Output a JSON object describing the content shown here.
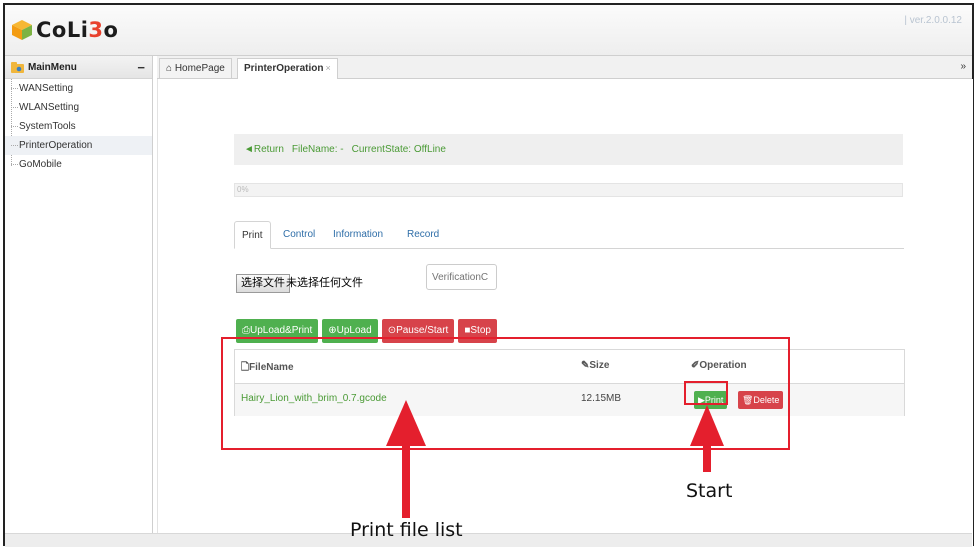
{
  "app": {
    "logo_text_a": "CoLi",
    "logo_text_b": "3",
    "logo_text_c": "o",
    "version": "| ver.2.0.0.12"
  },
  "sidebar": {
    "title": "MainMenu",
    "collapse_label": "−",
    "items": [
      {
        "label": "WANSetting"
      },
      {
        "label": "WLANSetting"
      },
      {
        "label": "SystemTools"
      },
      {
        "label": "PrinterOperation"
      },
      {
        "label": "GoMobile"
      }
    ]
  },
  "tabs": [
    {
      "label": "⌂ HomePage"
    },
    {
      "label": "PrinterOperation",
      "close": "×"
    }
  ],
  "tab_menu_icon": "»",
  "status": {
    "return_label": "◄Return",
    "filename": "FileName: -",
    "current_state": "CurrentState: OffLine"
  },
  "progress": {
    "value": 0,
    "label": "0%"
  },
  "op_tabs": [
    {
      "label": "Print"
    },
    {
      "label": "Control"
    },
    {
      "label": "Information"
    },
    {
      "label": "Record"
    }
  ],
  "upload": {
    "choose_file": "选择文件",
    "no_file": "未选择任何文件",
    "verification_placeholder": "VerificationC"
  },
  "buttons": {
    "upload_print": "⎙UpLoad&Print",
    "upload": "⊕UpLoad",
    "pause_start": "⊙Pause/Start",
    "stop": "■Stop"
  },
  "file_table": {
    "headers": {
      "filename": "🗋FileName",
      "size": "✎Size",
      "operation": "✐Operation"
    },
    "rows": [
      {
        "filename": "Hairy_Lion_with_brim_0.7.gcode",
        "size": "12.15MB",
        "print": "▶Print",
        "delete": "🗑Delete"
      }
    ]
  },
  "annotations": {
    "start": "Start",
    "print_file_list": "Print file list",
    "color": "#e41f2d"
  }
}
